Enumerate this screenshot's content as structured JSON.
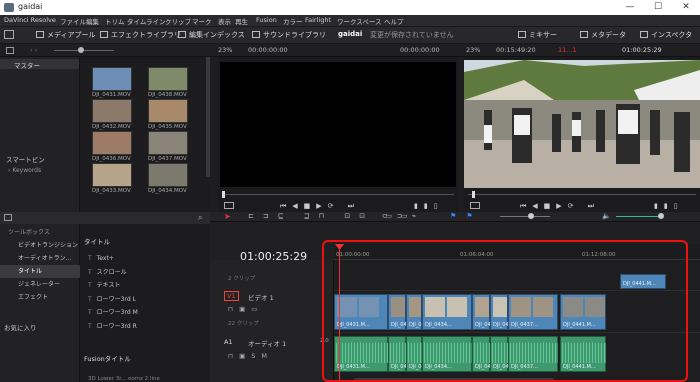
{
  "window": {
    "title": "gaidai",
    "min": "—",
    "max": "☐",
    "close": "✕"
  },
  "menu": [
    "DaVinci Resolve",
    "ファイル",
    "編集",
    "トリム",
    "タイムライン",
    "クリップ",
    "マーク",
    "表示",
    "再生",
    "Fusion",
    "カラー",
    "Fairlight",
    "ワークスペース",
    "ヘルプ"
  ],
  "toolbar": {
    "media_pool": "メディアプール",
    "effects_library": "エフェクトライブラリ",
    "edit_index": "編集インデックス",
    "sound_library": "サウンドライブラリ",
    "project_name": "gaidai",
    "project_status": "変更が保存されていません",
    "mixer": "ミキサー",
    "metadata": "メタデータ",
    "inspector": "インスペクタ"
  },
  "subbar": {
    "zoom_left": "23%",
    "tc_left": "00:00:00:00",
    "tc_left2": "00:00:00:00",
    "zoom_right": "23%",
    "tc_right": "00:15:49:20",
    "tc_right_red": "11...1",
    "tc_right2": "01:00:25:29"
  },
  "bins": {
    "master": "マスター",
    "smart_bins": "スマートビン",
    "keywords": "Keywords"
  },
  "media": [
    {
      "name": "DJI_0431.MOV",
      "color": "#6d8fb5"
    },
    {
      "name": "DJI_0438.MOV",
      "color": "#7f8a6a"
    },
    {
      "name": "DJI_0432.MOV",
      "color": "#8b7a6a"
    },
    {
      "name": "DJI_0435.MOV",
      "color": "#a88a6a"
    },
    {
      "name": "DJI_0436.MOV",
      "color": "#9c7c66"
    },
    {
      "name": "DJI_0437.MOV",
      "color": "#8a8478"
    },
    {
      "name": "DJI_0433.MOV",
      "color": "#b6a48a"
    },
    {
      "name": "DJI_0434.MOV",
      "color": "#7c7a6c"
    }
  ],
  "toolbox": {
    "tree": [
      "ツールボックス",
      "ビデオトランジション",
      "オーディオトラン...",
      "タイトル",
      "ジェネレーター",
      "エフェクト"
    ],
    "favorites": "お気に入り",
    "titles_header": "タイトル",
    "titles": [
      "Text+",
      "スクロール",
      "テキスト",
      "ローワー3rd L",
      "ローワー3rd M",
      "ローワー3rd R"
    ],
    "fusion_titles_header": "Fusionタイトル",
    "fusion_item": "3D Lower 3r... oomz 2 line"
  },
  "timeline": {
    "timecode": "01:00:25:29",
    "ruler": [
      "01:00:00:00",
      "01:06:04:00",
      "01:12:08:00"
    ],
    "v2_label": "2 クリップ",
    "v1_tag": "V1",
    "v1_name": "ビデオ 1",
    "v1_count": "22 クリップ",
    "a1_tag": "A1",
    "a1_name": "オーディオ 1",
    "a1_vol": "2.0",
    "top_clip": "DJI_0441.M...",
    "video_clips": [
      "DJI_0431.M...",
      "DJI_04...",
      "DJI_04...",
      "DJI_0434...",
      "DJI_04...",
      "DJI_04...",
      "DJI_0437...",
      "DJI_0441.M..."
    ],
    "audio_clips": [
      "DJI_0431.M...",
      "DJI_043...",
      "DJI_043...",
      "DJI_0434...",
      "DJI_043...",
      "DJI_043...",
      "DJI_0437...",
      "DJI_0441.M..."
    ]
  },
  "colors": {
    "accent_red": "#e11111",
    "clip_blue": "#4f86b8",
    "clip_green": "#3e9a6e"
  }
}
